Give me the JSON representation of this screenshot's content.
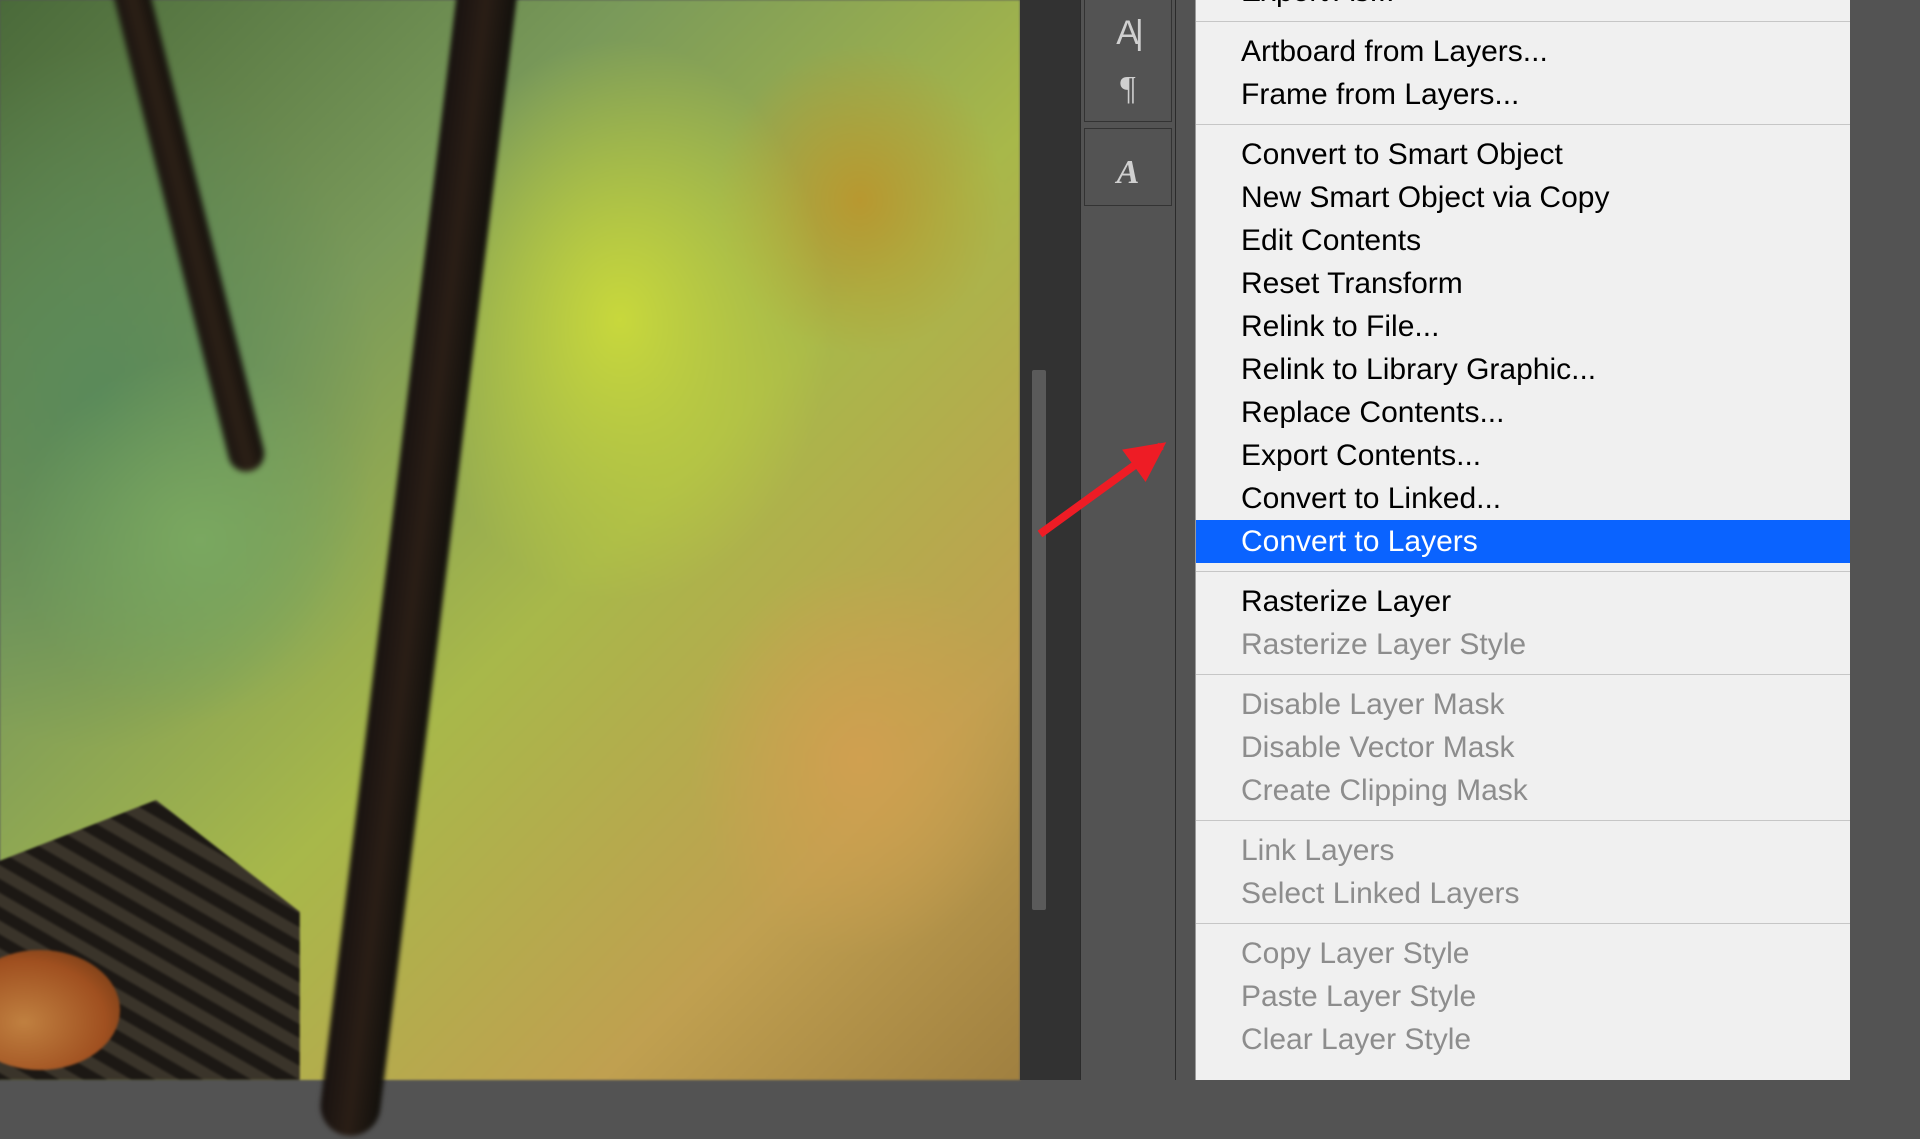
{
  "toolPanel": {
    "btnTypeCursor": "A|",
    "btnParagraph": "¶",
    "btnGlyph": "A"
  },
  "contextMenu": {
    "items": [
      {
        "label": "Export As...",
        "disabled": false,
        "highlight": false,
        "sepAfter": true,
        "cutTop": true
      },
      {
        "label": "Artboard from Layers...",
        "disabled": false,
        "highlight": false,
        "sepAfter": false
      },
      {
        "label": "Frame from Layers...",
        "disabled": false,
        "highlight": false,
        "sepAfter": true
      },
      {
        "label": "Convert to Smart Object",
        "disabled": false,
        "highlight": false,
        "sepAfter": false
      },
      {
        "label": "New Smart Object via Copy",
        "disabled": false,
        "highlight": false,
        "sepAfter": false
      },
      {
        "label": "Edit Contents",
        "disabled": false,
        "highlight": false,
        "sepAfter": false
      },
      {
        "label": "Reset Transform",
        "disabled": false,
        "highlight": false,
        "sepAfter": false
      },
      {
        "label": "Relink to File...",
        "disabled": false,
        "highlight": false,
        "sepAfter": false
      },
      {
        "label": "Relink to Library Graphic...",
        "disabled": false,
        "highlight": false,
        "sepAfter": false
      },
      {
        "label": "Replace Contents...",
        "disabled": false,
        "highlight": false,
        "sepAfter": false
      },
      {
        "label": "Export Contents...",
        "disabled": false,
        "highlight": false,
        "sepAfter": false
      },
      {
        "label": "Convert to Linked...",
        "disabled": false,
        "highlight": false,
        "sepAfter": false
      },
      {
        "label": "Convert to Layers",
        "disabled": false,
        "highlight": true,
        "sepAfter": true
      },
      {
        "label": "Rasterize Layer",
        "disabled": false,
        "highlight": false,
        "sepAfter": false
      },
      {
        "label": "Rasterize Layer Style",
        "disabled": true,
        "highlight": false,
        "sepAfter": true
      },
      {
        "label": "Disable Layer Mask",
        "disabled": true,
        "highlight": false,
        "sepAfter": false
      },
      {
        "label": "Disable Vector Mask",
        "disabled": true,
        "highlight": false,
        "sepAfter": false
      },
      {
        "label": "Create Clipping Mask",
        "disabled": true,
        "highlight": false,
        "sepAfter": true
      },
      {
        "label": "Link Layers",
        "disabled": true,
        "highlight": false,
        "sepAfter": false
      },
      {
        "label": "Select Linked Layers",
        "disabled": true,
        "highlight": false,
        "sepAfter": true
      },
      {
        "label": "Copy Layer Style",
        "disabled": true,
        "highlight": false,
        "sepAfter": false
      },
      {
        "label": "Paste Layer Style",
        "disabled": true,
        "highlight": false,
        "sepAfter": false
      },
      {
        "label": "Clear Layer Style",
        "disabled": true,
        "highlight": false,
        "sepAfter": false
      }
    ]
  }
}
